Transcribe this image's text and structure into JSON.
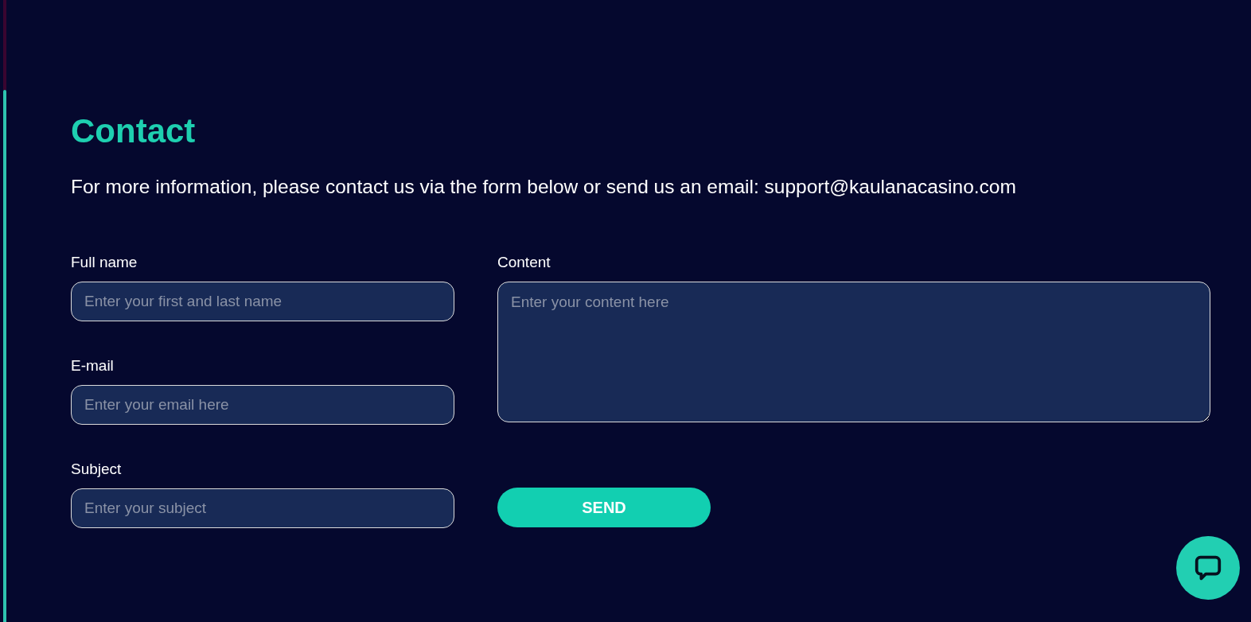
{
  "title": "Contact",
  "intro": "For more information, please contact us via the form below or send us an email: support@kaulanacasino.com",
  "left_fields": [
    {
      "kind": "input",
      "label": "Full name",
      "placeholder": "Enter your first and last name"
    },
    {
      "kind": "input",
      "label": "E-mail",
      "placeholder": "Enter your email here"
    },
    {
      "kind": "input",
      "label": "Subject",
      "placeholder": "Enter your subject"
    }
  ],
  "right_fields": [
    {
      "kind": "textarea",
      "label": "Content",
      "placeholder": "Enter your content here"
    }
  ],
  "send_button": "SEND"
}
